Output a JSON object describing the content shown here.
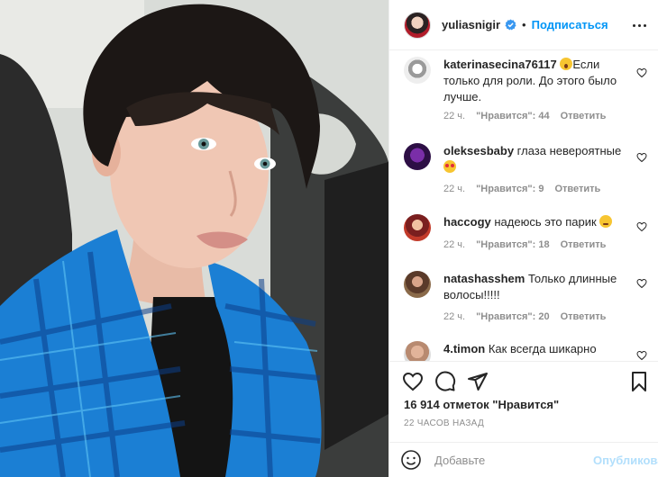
{
  "post": {
    "username": "yuliasnigir",
    "dot": "•",
    "follow_label": "Подписаться",
    "likes_text": "16 914 отметок \"Нравится\"",
    "time_text": "22 ЧАСОВ НАЗАД"
  },
  "comments": [
    {
      "user": "katerinasecina76117",
      "emoji": "wow",
      "text": "Если только для роли. До этого было лучше.",
      "time": "22 ч.",
      "likes": "\"Нравится\": 44",
      "reply": "Ответить"
    },
    {
      "user": "oleksesbaby",
      "text": "глаза невероятные",
      "emoji_after": "heart-eyes",
      "time": "22 ч.",
      "likes": "\"Нравится\": 9",
      "reply": "Ответить"
    },
    {
      "user": "haccogy",
      "text": "надеюсь это парик",
      "emoji_after": "worried",
      "time": "22 ч.",
      "likes": "\"Нравится\": 18",
      "reply": "Ответить"
    },
    {
      "user": "natashasshem",
      "text": "Только длинные волосы!!!!!",
      "time": "22 ч.",
      "likes": "\"Нравится\": 20",
      "reply": "Ответить"
    },
    {
      "user": "4.timon",
      "text": "Как всегда шикарно"
    }
  ],
  "composer": {
    "placeholder": "Добавьте комментарий...",
    "shown_text": "Добавьте",
    "publish_label": "Опубликовать"
  },
  "colors": {
    "accent": "#0095f6",
    "publish_disabled": "#b2dffc",
    "meta_gray": "#8e8e8e"
  }
}
